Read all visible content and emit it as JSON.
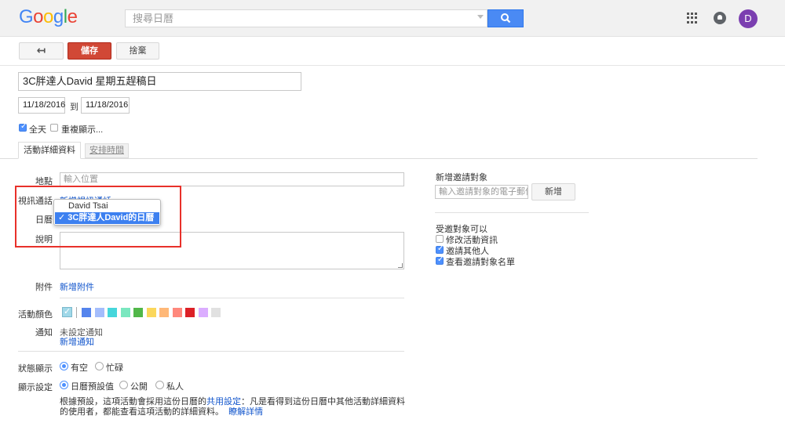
{
  "header": {
    "logo": {
      "l1": "G",
      "l2": "o",
      "l3": "o",
      "l4": "g",
      "l5": "l",
      "l6": "e"
    },
    "search_placeholder": "搜尋日曆",
    "avatar_letter": "D"
  },
  "toolbar": {
    "back_label": "↤",
    "save_label": "儲存",
    "discard_label": "捨棄"
  },
  "event": {
    "title": "3C胖達人David 星期五趕稿日",
    "start_date": "11/18/2016",
    "date_sep": "到",
    "end_date": "11/18/2016",
    "all_day_label": "全天",
    "all_day_checked": true,
    "repeat_label": "重複顯示..."
  },
  "tabs": {
    "details": "活動詳細資料",
    "schedule": "安排時間"
  },
  "form": {
    "location_label": "地點",
    "location_placeholder": "輸入位置",
    "video_label": "視訊通話",
    "video_link": "新增視訊通話",
    "calendar_label": "日曆",
    "description_label": "說明",
    "attachment_label": "附件",
    "attachment_link": "新增附件",
    "color_label": "活動顏色",
    "colors": [
      "#5484ed",
      "#a4bdfc",
      "#46d6db",
      "#7ae7bf",
      "#51b749",
      "#fbd75b",
      "#ffb878",
      "#ff887c",
      "#dc2127",
      "#dbadff",
      "#e1e1e1"
    ],
    "notify_label": "通知",
    "notify_value": "未設定通知",
    "notify_link": "新增通知",
    "status_label": "狀態顯示",
    "status_options": [
      "有空",
      "忙碌"
    ],
    "status_selected": 0,
    "visibility_label": "顯示設定",
    "visibility_options": [
      "日曆預設值",
      "公開",
      "私人"
    ],
    "visibility_selected": 0,
    "footer_part1": "根據預設，這項活動會採用這份日曆的",
    "footer_link1": "共用設定",
    "footer_part2": "：凡是看得到這份日曆中其他活動詳細資料的使用者，都能查看這項活動的詳細資料。",
    "footer_link2": "瞭解詳情"
  },
  "calendar_dropdown": {
    "options": [
      "David Tsai",
      "3C胖達人David的日曆"
    ],
    "selected_index": 1,
    "check": "✓"
  },
  "guests": {
    "title": "新增邀請對象",
    "input_placeholder": "輸入邀請對象的電子郵件",
    "add_label": "新增",
    "permissions_title": "受邀對象可以",
    "permissions": [
      {
        "label": "修改活動資訊",
        "checked": false
      },
      {
        "label": "邀請其他人",
        "checked": true
      },
      {
        "label": "查看邀請對象名單",
        "checked": true
      }
    ]
  },
  "colors": {
    "accent": "#4d90fe",
    "save_red": "#d14836",
    "link": "#1155cc",
    "highlight_box": "#e8302a"
  }
}
